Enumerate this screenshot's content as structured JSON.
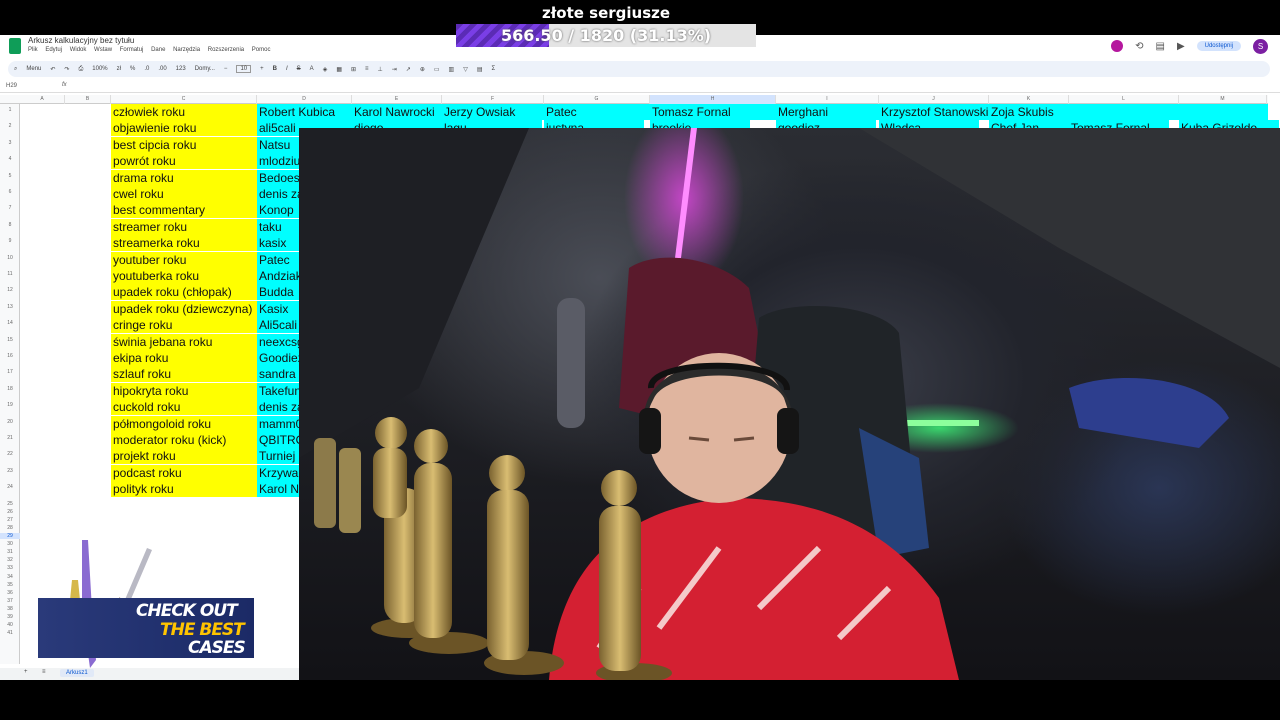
{
  "goal_overlay": {
    "title": "złote sergiusze",
    "progress_text": "566.50 / 1820 (31.13%)",
    "progress_fraction": 0.3113
  },
  "sheets": {
    "doc_title": "Arkusz kalkulacyjny bez tytułu",
    "menu": [
      "Plik",
      "Edytuj",
      "Widok",
      "Wstaw",
      "Formatuj",
      "Dane",
      "Narzędzia",
      "Rozszerzenia",
      "Pomoc"
    ],
    "share_label": "Udostępnij",
    "avatar_letter": "S",
    "toolbar": {
      "search": "Menu",
      "zoom": "100%",
      "currency": "zł",
      "percent": "%",
      "dec1": ".0",
      "dec2": ".00",
      "numfmt": "123",
      "font": "Domy...",
      "font_size": "10"
    },
    "cell_ref": "H29",
    "fx": "fx",
    "columns": [
      "A",
      "B",
      "C",
      "D",
      "E",
      "F",
      "G",
      "H",
      "I",
      "J",
      "K",
      "L",
      "M"
    ],
    "selected_column": "H",
    "row_numbers": [
      "1",
      "2",
      "3",
      "4",
      "5",
      "6",
      "7",
      "8",
      "9",
      "10",
      "11",
      "12",
      "13",
      "14",
      "15",
      "16",
      "17",
      "18",
      "19",
      "20",
      "21",
      "22",
      "23",
      "24",
      "25",
      "26",
      "27",
      "28",
      "29",
      "30",
      "31",
      "32",
      "33",
      "34",
      "35",
      "36",
      "37",
      "38",
      "39",
      "40",
      "41"
    ],
    "selected_row": "29",
    "categories": [
      "człowiek roku",
      "objawienie roku",
      "best cipcia roku",
      "powrót roku",
      "drama roku",
      "cwel roku",
      "best commentary",
      "streamer roku",
      "streamerka roku",
      "youtuber roku",
      "youtuberka roku",
      "upadek roku (chłopak)",
      "upadek roku (dziewczyna)",
      "cringe roku",
      "świnia jebana roku",
      "ekipa roku",
      "szlauf roku",
      "hipokryta roku",
      "cuckold roku",
      "półmongoloid roku",
      "moderator roku (kick)",
      "projekt roku",
      "podcast roku",
      "polityk roku"
    ],
    "column_d": [
      "Robert Kubica",
      "ali5cali",
      "Natsu",
      "mlodziu",
      "Bedoes",
      "denis za",
      "Konop",
      "taku",
      "kasix",
      "Patec",
      "Andziak",
      "Budda",
      "Kasix",
      "Ali5cali",
      "neexcsg",
      "Goodiez",
      "sandra",
      "Takefun",
      "denis za",
      "mamm0",
      "QBITRO",
      "Turniej",
      "Krzywa",
      "Karol Na"
    ],
    "row1_rest": [
      "Karol Nawrocki",
      "Jerzy Owsiak",
      "Patec",
      "Tomasz Fornal",
      "Merghani",
      "Krzysztof Stanowski",
      "Zoja Skubis"
    ],
    "row2_partial": [
      "diego",
      "lagu",
      "justyna",
      "brookie",
      "goodiez",
      "Wladca",
      "Chef Jan",
      "Tomasz Fornal",
      "Kuba Grizoldo"
    ],
    "sheet_tab": "Arkusz1"
  },
  "promo": {
    "line1": "CHECK OUT",
    "line2": "THE BEST",
    "line3": "CASES"
  },
  "colors": {
    "yellow": "#ffff00",
    "cyan": "#00ffff",
    "goal_fill": "#6a34d6",
    "promo_blue": "#22306f",
    "promo_gold": "#ffc400"
  }
}
